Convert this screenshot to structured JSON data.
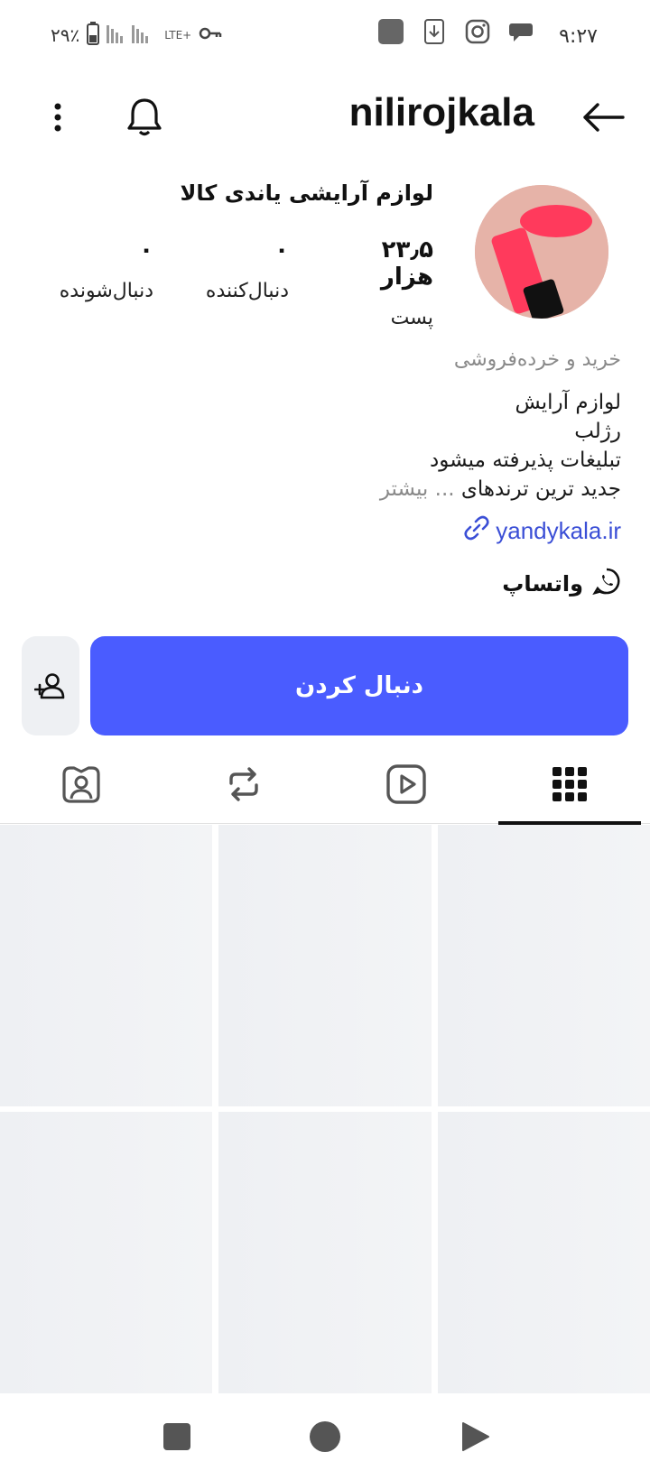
{
  "status_bar": {
    "time": "۹:۲۷",
    "battery_percent": "۲۹٪",
    "network": "LTE+"
  },
  "header": {
    "username": "nilirojkala"
  },
  "profile": {
    "display_name": "لوازم آرایشی یاندی کالا",
    "stats": {
      "posts_value": "۲۳٫۵ هزار",
      "posts_label": "پست",
      "followers_value": "۰",
      "followers_label": "دنبال‌کننده",
      "following_value": "۰",
      "following_label": "دنبال‌شونده"
    },
    "category": "خرید و خرده‌فروشی",
    "bio_lines": [
      "لوازم آرایش",
      "رژلب",
      "تبلیغات پذیرفته میشود",
      "جدید ترین ترندهای"
    ],
    "bio_more": "... بیشتر",
    "link": "yandykala.ir",
    "whatsapp_label": "واتساپ"
  },
  "actions": {
    "follow_label": "دنبال کردن"
  },
  "colors": {
    "accent": "#4a5cff",
    "link": "#3b4fd6",
    "grid_placeholder": "#eef0f3"
  }
}
